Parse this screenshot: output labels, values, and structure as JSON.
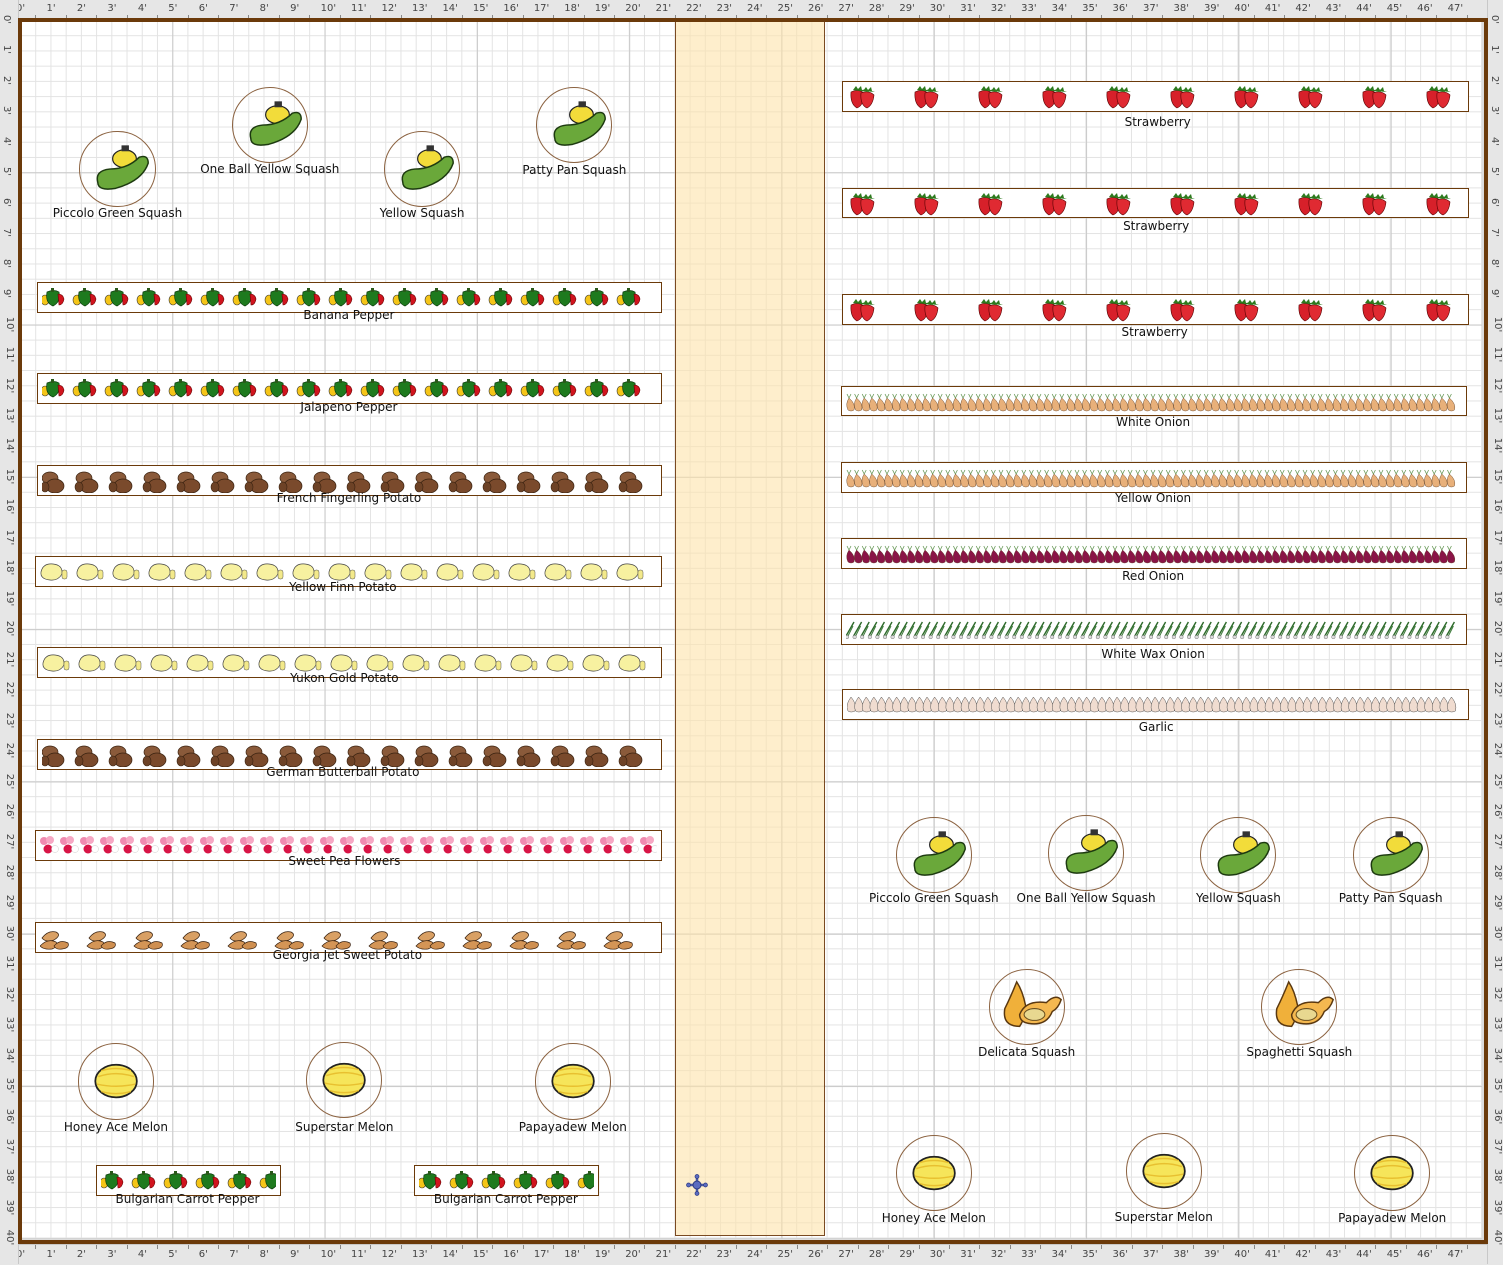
{
  "app": {
    "view": "garden-planner-grid",
    "units": "feet",
    "width_ft": 48,
    "height_ft": 40
  },
  "rulers": {
    "top_labels": [
      "0'",
      "1'",
      "2'",
      "3'",
      "4'",
      "5'",
      "6'",
      "7'",
      "8'",
      "9'",
      "10'",
      "11'",
      "12'",
      "13'",
      "14'",
      "15'",
      "16'",
      "17'",
      "18'",
      "19'",
      "20'",
      "21'",
      "22'",
      "23'",
      "24'",
      "25'",
      "26'",
      "27'",
      "28'",
      "29'",
      "30'",
      "31'",
      "32'",
      "33'",
      "34'",
      "35'",
      "36'",
      "37'",
      "38'",
      "39'",
      "40'",
      "41'",
      "42'",
      "43'",
      "44'",
      "45'",
      "46'",
      "47'"
    ],
    "side_labels": [
      "0'",
      "1'",
      "2'",
      "3'",
      "4'",
      "5'",
      "6'",
      "7'",
      "8'",
      "9'",
      "10'",
      "11'",
      "12'",
      "13'",
      "14'",
      "15'",
      "16'",
      "17'",
      "18'",
      "19'",
      "20'",
      "21'",
      "22'",
      "23'",
      "24'",
      "25'",
      "26'",
      "27'",
      "28'",
      "29'",
      "30'",
      "31'",
      "32'",
      "33'",
      "34'",
      "35'",
      "36'",
      "37'",
      "38'",
      "39'",
      "40'"
    ]
  },
  "colors": {
    "border": "#6b3a0a",
    "path_fill": "#fde2aa",
    "grid_major": "#c9c9c9",
    "grid_minor": "#e3e3e3",
    "plant_ring": "#8b6240"
  },
  "path": {
    "name": "Path"
  },
  "rows": [
    {
      "label": "Banana Pepper",
      "icon": "pepper"
    },
    {
      "label": "Jalapeno Pepper",
      "icon": "pepper"
    },
    {
      "label": "French Fingerling Potato",
      "icon": "brown-potato"
    },
    {
      "label": "Yellow Finn Potato",
      "icon": "yellow-potato"
    },
    {
      "label": "Yukon Gold Potato",
      "icon": "yellow-potato"
    },
    {
      "label": "German Butterball Potato",
      "icon": "brown-potato"
    },
    {
      "label": "Sweet Pea Flowers",
      "icon": "flower"
    },
    {
      "label": "Georgia Jet Sweet Potato",
      "icon": "sweet-potato"
    },
    {
      "label": "Bulgarian Carrot Pepper",
      "icon": "pepper"
    },
    {
      "label": "Bulgarian Carrot Pepper",
      "icon": "pepper"
    },
    {
      "label": "Strawberry",
      "icon": "strawberry"
    },
    {
      "label": "Strawberry",
      "icon": "strawberry"
    },
    {
      "label": "Strawberry",
      "icon": "strawberry"
    },
    {
      "label": "White Onion",
      "icon": "onion"
    },
    {
      "label": "Yellow Onion",
      "icon": "onion"
    },
    {
      "label": "Red Onion",
      "icon": "red-onion"
    },
    {
      "label": "White Wax Onion",
      "icon": "scallion"
    },
    {
      "label": "Garlic",
      "icon": "garlic"
    }
  ],
  "plants": [
    {
      "label": "Piccolo Green Squash",
      "icon": "summer-squash"
    },
    {
      "label": "One Ball Yellow Squash",
      "icon": "summer-squash"
    },
    {
      "label": "Yellow Squash",
      "icon": "summer-squash"
    },
    {
      "label": "Patty Pan Squash",
      "icon": "summer-squash"
    },
    {
      "label": "Honey Ace Melon",
      "icon": "melon"
    },
    {
      "label": "Superstar Melon",
      "icon": "melon"
    },
    {
      "label": "Papayadew Melon",
      "icon": "melon"
    },
    {
      "label": "Piccolo Green Squash",
      "icon": "summer-squash"
    },
    {
      "label": "One Ball Yellow Squash",
      "icon": "summer-squash"
    },
    {
      "label": "Yellow Squash",
      "icon": "summer-squash"
    },
    {
      "label": "Patty Pan Squash",
      "icon": "summer-squash"
    },
    {
      "label": "Delicata Squash",
      "icon": "winter-squash"
    },
    {
      "label": "Spaghetti Squash",
      "icon": "winter-squash"
    },
    {
      "label": "Honey Ace Melon",
      "icon": "melon"
    },
    {
      "label": "Superstar Melon",
      "icon": "melon"
    },
    {
      "label": "Papayadew Melon",
      "icon": "melon"
    }
  ],
  "compass": {
    "icon": "compass-move-icon"
  }
}
